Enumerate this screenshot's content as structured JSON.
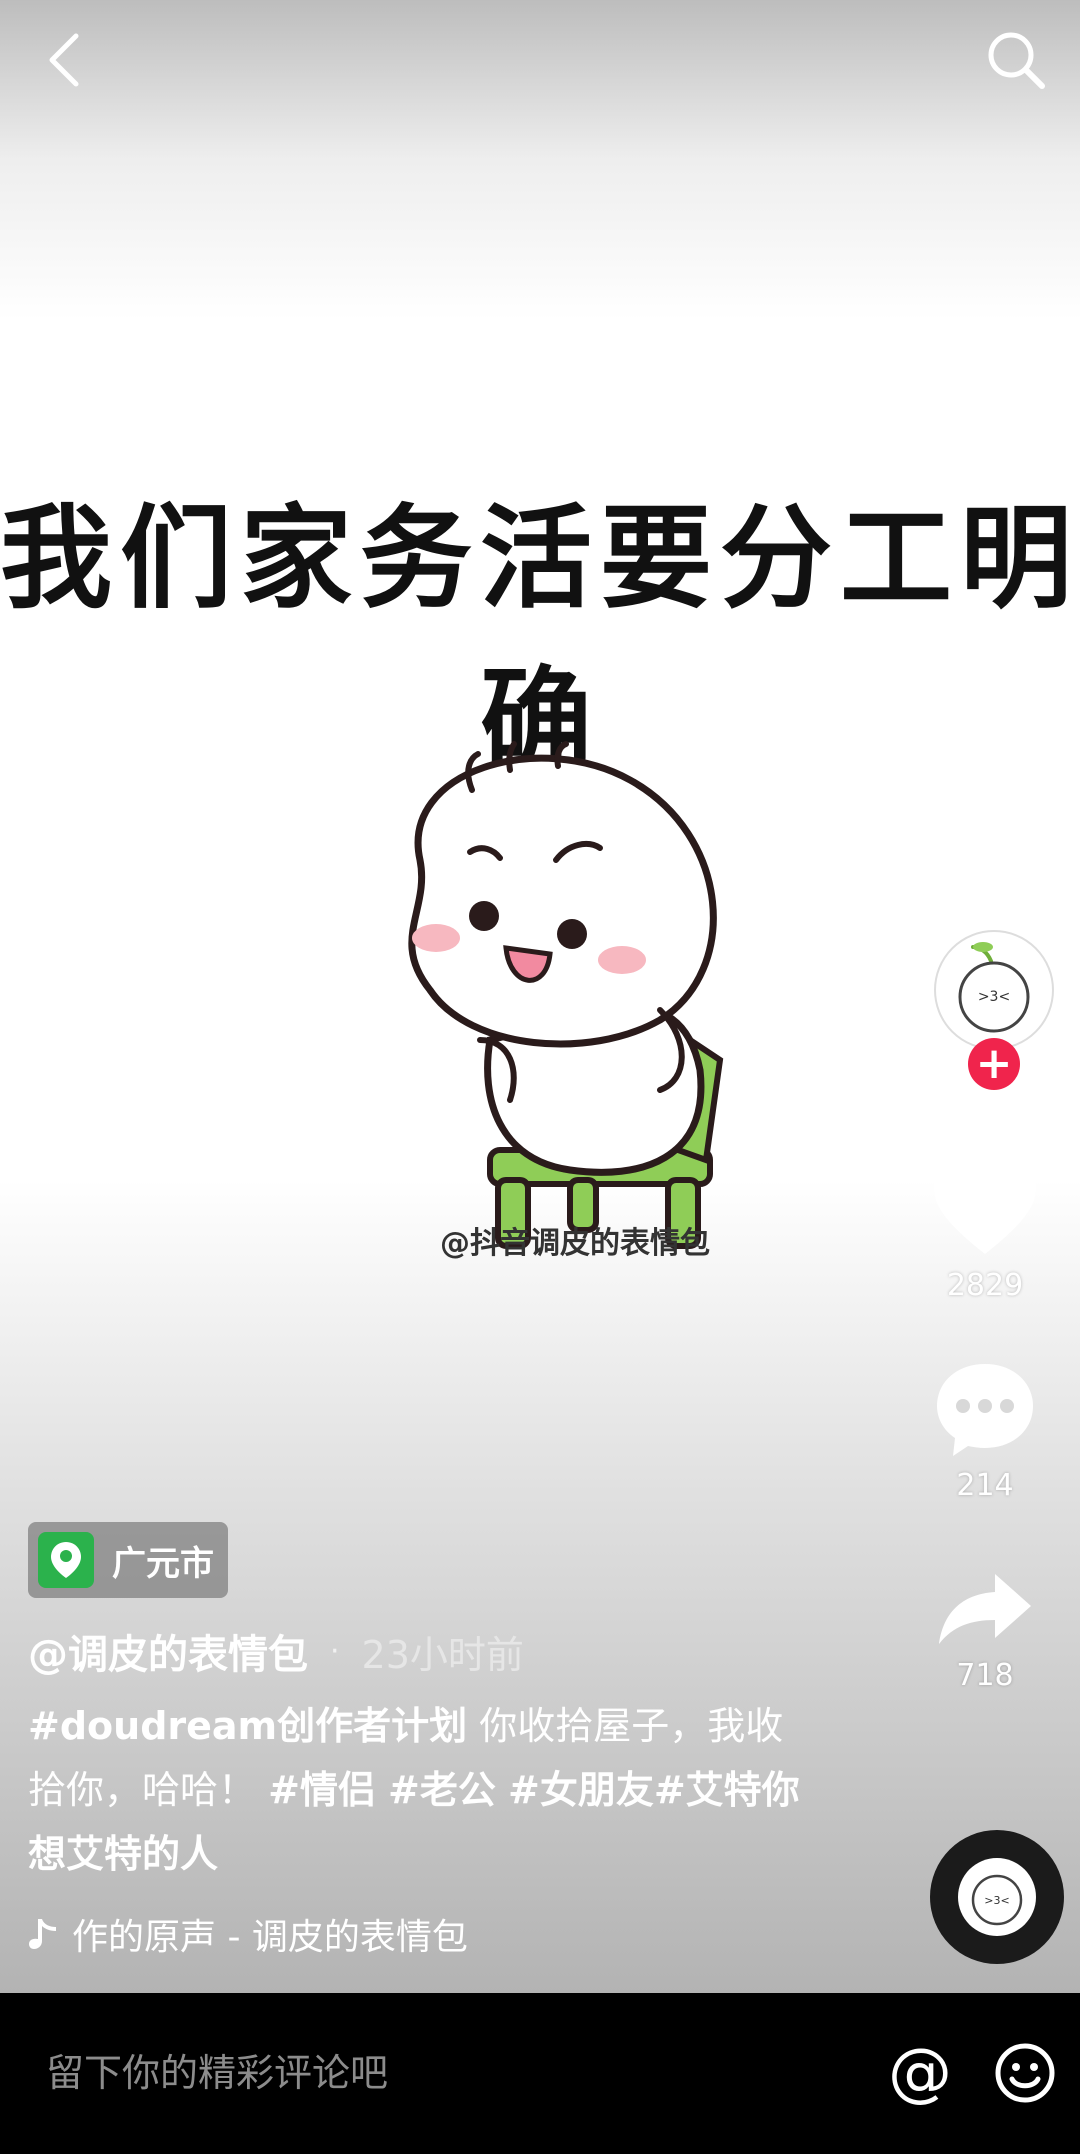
{
  "caption": "我们家务活要分工明确",
  "watermark": "@抖音调皮的表情包",
  "sidebar": {
    "likes": "2829",
    "comments": "214",
    "shares": "718"
  },
  "location": {
    "label": "广元市",
    "color": "#2bb24c"
  },
  "post": {
    "author": "@调皮的表情包",
    "separator": "·",
    "time": "23小时前",
    "tag1": "#doudream创作者计划",
    "text1": "你收拾屋子，我收拾你，哈哈！",
    "tag2": "#情侣",
    "tag3": "#老公",
    "tag4": "#女朋友",
    "tag5": "#艾特你想艾特的人"
  },
  "music": {
    "label": "作的原声 - 调皮的表情包"
  },
  "comment_bar": {
    "placeholder": "留下你的精彩评论吧",
    "at_symbol": "@"
  },
  "colors": {
    "follow": "#f0244c",
    "bar": "#000000"
  }
}
